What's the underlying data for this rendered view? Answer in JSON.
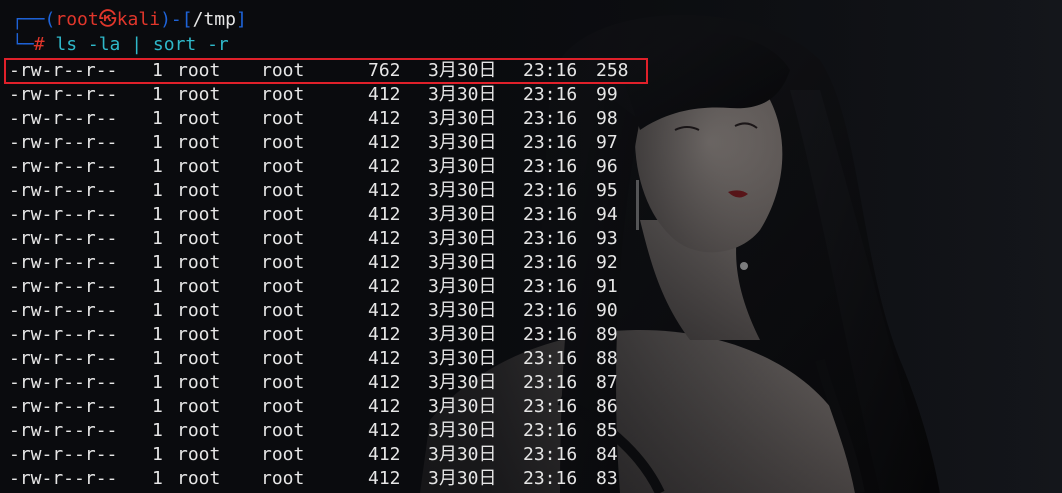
{
  "prompt": {
    "corner_top": "┌──",
    "open_paren": "(",
    "user": "root",
    "skull": "㉿",
    "host": "kali",
    "close_paren": ")",
    "dash": "-",
    "open_bracket": "[",
    "path": "/tmp",
    "close_bracket": "]",
    "corner_bottom": "└─",
    "hash": "#",
    "command": "ls -la | sort -r"
  },
  "listing": [
    {
      "perm": "-rw-r--r--",
      "links": "1",
      "owner": "root",
      "group": "root",
      "size": "762",
      "month": "3月30日",
      "time": "23:16",
      "name": "258",
      "highlighted": true
    },
    {
      "perm": "-rw-r--r--",
      "links": "1",
      "owner": "root",
      "group": "root",
      "size": "412",
      "month": "3月30日",
      "time": "23:16",
      "name": "99"
    },
    {
      "perm": "-rw-r--r--",
      "links": "1",
      "owner": "root",
      "group": "root",
      "size": "412",
      "month": "3月30日",
      "time": "23:16",
      "name": "98"
    },
    {
      "perm": "-rw-r--r--",
      "links": "1",
      "owner": "root",
      "group": "root",
      "size": "412",
      "month": "3月30日",
      "time": "23:16",
      "name": "97"
    },
    {
      "perm": "-rw-r--r--",
      "links": "1",
      "owner": "root",
      "group": "root",
      "size": "412",
      "month": "3月30日",
      "time": "23:16",
      "name": "96"
    },
    {
      "perm": "-rw-r--r--",
      "links": "1",
      "owner": "root",
      "group": "root",
      "size": "412",
      "month": "3月30日",
      "time": "23:16",
      "name": "95"
    },
    {
      "perm": "-rw-r--r--",
      "links": "1",
      "owner": "root",
      "group": "root",
      "size": "412",
      "month": "3月30日",
      "time": "23:16",
      "name": "94"
    },
    {
      "perm": "-rw-r--r--",
      "links": "1",
      "owner": "root",
      "group": "root",
      "size": "412",
      "month": "3月30日",
      "time": "23:16",
      "name": "93"
    },
    {
      "perm": "-rw-r--r--",
      "links": "1",
      "owner": "root",
      "group": "root",
      "size": "412",
      "month": "3月30日",
      "time": "23:16",
      "name": "92"
    },
    {
      "perm": "-rw-r--r--",
      "links": "1",
      "owner": "root",
      "group": "root",
      "size": "412",
      "month": "3月30日",
      "time": "23:16",
      "name": "91"
    },
    {
      "perm": "-rw-r--r--",
      "links": "1",
      "owner": "root",
      "group": "root",
      "size": "412",
      "month": "3月30日",
      "time": "23:16",
      "name": "90"
    },
    {
      "perm": "-rw-r--r--",
      "links": "1",
      "owner": "root",
      "group": "root",
      "size": "412",
      "month": "3月30日",
      "time": "23:16",
      "name": "89"
    },
    {
      "perm": "-rw-r--r--",
      "links": "1",
      "owner": "root",
      "group": "root",
      "size": "412",
      "month": "3月30日",
      "time": "23:16",
      "name": "88"
    },
    {
      "perm": "-rw-r--r--",
      "links": "1",
      "owner": "root",
      "group": "root",
      "size": "412",
      "month": "3月30日",
      "time": "23:16",
      "name": "87"
    },
    {
      "perm": "-rw-r--r--",
      "links": "1",
      "owner": "root",
      "group": "root",
      "size": "412",
      "month": "3月30日",
      "time": "23:16",
      "name": "86"
    },
    {
      "perm": "-rw-r--r--",
      "links": "1",
      "owner": "root",
      "group": "root",
      "size": "412",
      "month": "3月30日",
      "time": "23:16",
      "name": "85"
    },
    {
      "perm": "-rw-r--r--",
      "links": "1",
      "owner": "root",
      "group": "root",
      "size": "412",
      "month": "3月30日",
      "time": "23:16",
      "name": "84"
    },
    {
      "perm": "-rw-r--r--",
      "links": "1",
      "owner": "root",
      "group": "root",
      "size": "412",
      "month": "3月30日",
      "time": "23:16",
      "name": "83"
    }
  ],
  "colors": {
    "prompt_frame": "#1e63d8",
    "prompt_user_host": "#e0362b",
    "command": "#2fb8c9",
    "text": "#e6e6e6",
    "highlight_box": "#e0202a",
    "background": "#0a0b0e"
  },
  "background_image": "dark-haired-woman-illustration-wallpaper"
}
